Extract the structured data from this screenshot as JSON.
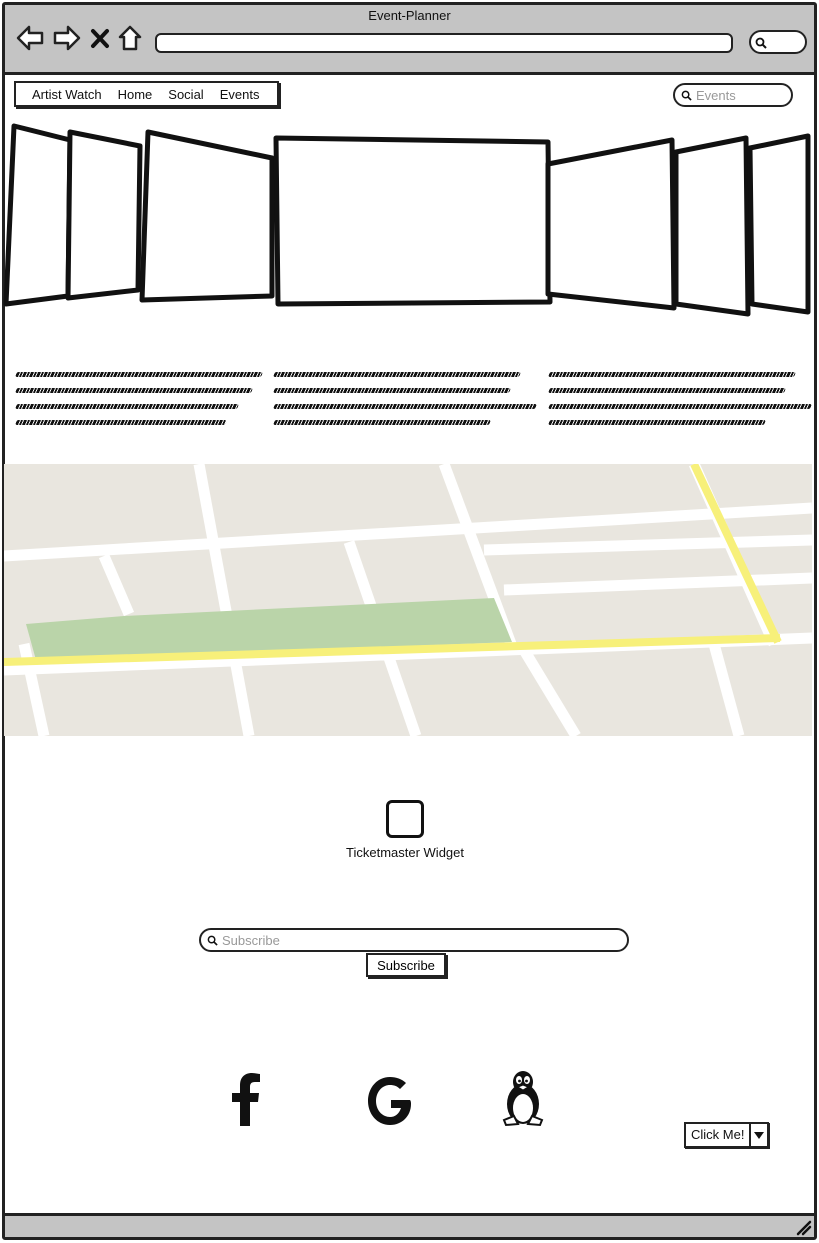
{
  "window": {
    "title": "Event-Planner"
  },
  "nav": {
    "items": [
      {
        "label": "Artist Watch"
      },
      {
        "label": "Home"
      },
      {
        "label": "Social"
      },
      {
        "label": "Events"
      }
    ]
  },
  "search": {
    "placeholder": "Events"
  },
  "map": {
    "colors": {
      "land": "#e9e6df",
      "road": "#ffffff",
      "park": "#bad4a9",
      "highway": "#f7f07a"
    }
  },
  "widget": {
    "label": "Ticketmaster Widget"
  },
  "subscribe": {
    "placeholder": "Subscribe",
    "button_label": "Subscribe"
  },
  "social": {
    "icons": [
      "facebook-icon",
      "google-icon",
      "linux-icon"
    ]
  },
  "split_button": {
    "label": "Click Me!"
  }
}
